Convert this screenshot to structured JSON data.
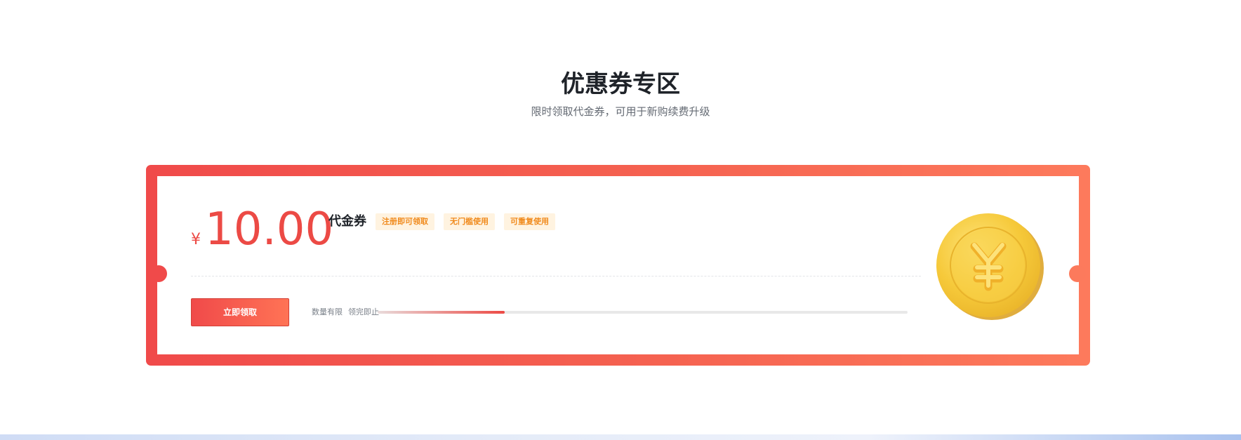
{
  "section": {
    "title": "优惠券专区",
    "subtitle": "限时领取代金券，可用于新购续费升级"
  },
  "coupon": {
    "currency_symbol": "¥",
    "amount": "10.00",
    "type_label": "代金券",
    "tags": [
      "注册即可领取",
      "无门槛使用",
      "可重复使用"
    ],
    "claim_button_label": "立即领取",
    "stock_note_1": "数量有限",
    "stock_note_2": "领完即止",
    "claimed_fraction": 0.24,
    "coin_icon": "yen-coin-icon"
  },
  "colors": {
    "accent_red": "#ec4a45",
    "tag_orange": "#f08a1c",
    "coin_gold": "#f6c93a"
  }
}
